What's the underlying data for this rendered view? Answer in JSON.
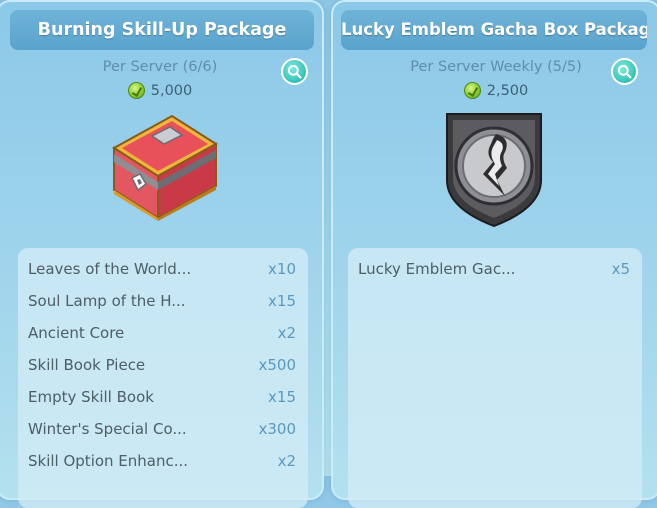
{
  "packages": [
    {
      "title": "Burning Skill-Up Package",
      "limit": "Per Server (6/6)",
      "price": "5,000",
      "image": "red-gold-treasure-chest",
      "items": [
        {
          "name": "Leaves of the World...",
          "qty": "x10"
        },
        {
          "name": "Soul Lamp of the H...",
          "qty": "x15"
        },
        {
          "name": "Ancient Core",
          "qty": "x2"
        },
        {
          "name": "Skill Book Piece",
          "qty": "x500"
        },
        {
          "name": "Empty Skill Book",
          "qty": "x15"
        },
        {
          "name": "Winter's Special Co...",
          "qty": "x300"
        },
        {
          "name": "Skill Option Enhanc...",
          "qty": "x2"
        }
      ]
    },
    {
      "title": "Lucky Emblem Gacha Box Package",
      "limit": "Per Server Weekly (5/5)",
      "price": "2,500",
      "image": "silver-emblem-shield",
      "items": [
        {
          "name": "Lucky Emblem Gac...",
          "qty": "x5"
        }
      ]
    }
  ],
  "icons": {
    "currency": "green-coin-icon",
    "details": "magnifier-search-icon"
  },
  "colors": {
    "background": "#9fd3ea",
    "title_bar": "#62a9d1",
    "details_button": "#33c3b6",
    "quantity_text": "#5a98be"
  }
}
